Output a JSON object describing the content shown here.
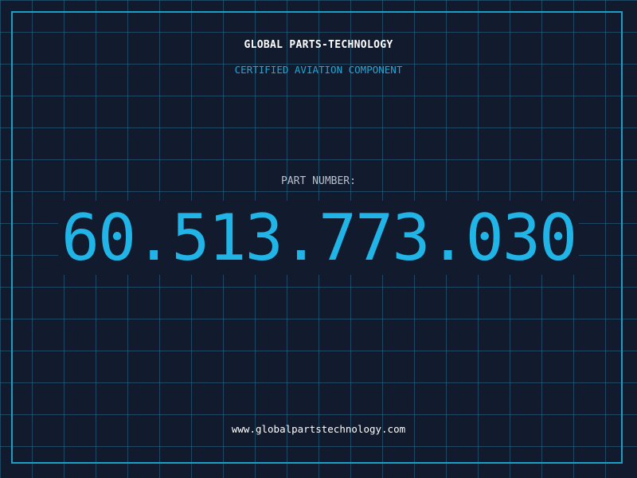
{
  "header": {
    "company": "GLOBAL PARTS-TECHNOLOGY",
    "tagline": "CERTIFIED AVIATION COMPONENT"
  },
  "part": {
    "label": "PART NUMBER:",
    "number": "60.513.773.030"
  },
  "footer": {
    "website": "www.globalpartstechnology.com"
  },
  "colors": {
    "background": "#121a2e",
    "grid": "#286e8c",
    "frame": "#1b9fc9",
    "accent": "#21b4e6",
    "label": "#b9c0cc",
    "primary_text": "#ffffff"
  }
}
